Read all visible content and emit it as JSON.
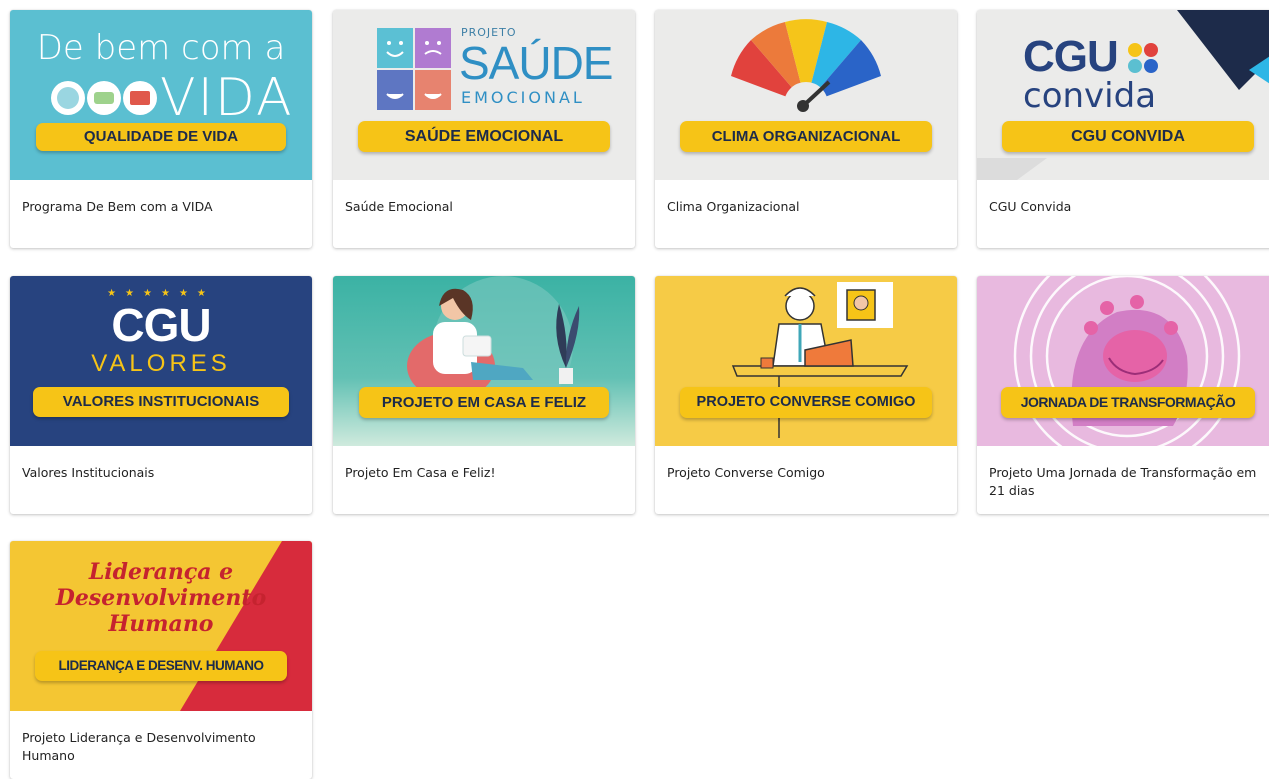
{
  "cards": [
    {
      "title": "Programa De Bem com a VIDA",
      "banner": "QUALIDADE DE VIDA",
      "art_line1": "De bem com a",
      "art_line2": "VIDA"
    },
    {
      "title": "Saúde Emocional",
      "banner": "SAÚDE EMOCIONAL",
      "art_small": "PROJETO",
      "art_big": "SAÚDE",
      "art_sub": "EMOCIONAL"
    },
    {
      "title": "Clima Organizacional",
      "banner": "CLIMA ORGANIZACIONAL"
    },
    {
      "title": "CGU Convida",
      "banner": "CGU CONVIDA",
      "art_big": "CGU",
      "art_sub": "convida"
    },
    {
      "title": "Valores Institucionais",
      "banner": "VALORES INSTITUCIONAIS",
      "art_big": "CGU",
      "art_sub": "VALORES"
    },
    {
      "title": "Projeto Em Casa e Feliz!",
      "banner": "PROJETO EM CASA E FELIZ"
    },
    {
      "title": "Projeto Converse Comigo",
      "banner": "PROJETO CONVERSE COMIGO"
    },
    {
      "title": "Projeto Uma Jornada de Transformação em 21 dias",
      "banner": "JORNADA DE TRANSFORMAÇÃO"
    },
    {
      "title": "Projeto Liderança e Desenvolvimento Humano",
      "banner": "LIDERANÇA E DESENV. HUMANO",
      "art_line1": "Liderança e",
      "art_line2": "Desenvolvimento",
      "art_line3": "Humano"
    }
  ],
  "colors": {
    "yellow": "#f6c417",
    "navy": "#1d2b4a",
    "teal": "#5bbfd1",
    "cgu_blue": "#27437f"
  }
}
